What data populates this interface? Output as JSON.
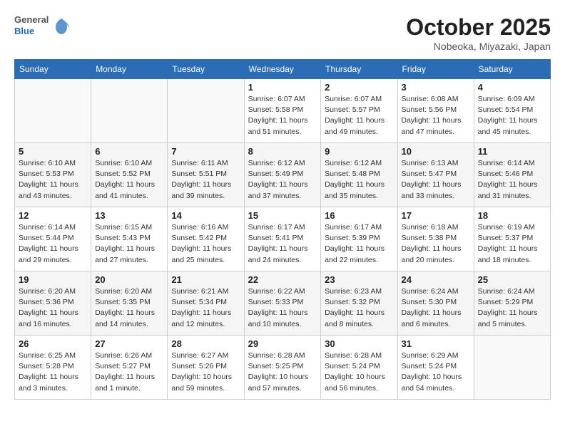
{
  "header": {
    "logo_general": "General",
    "logo_blue": "Blue",
    "month_title": "October 2025",
    "location": "Nobeoka, Miyazaki, Japan"
  },
  "weekdays": [
    "Sunday",
    "Monday",
    "Tuesday",
    "Wednesday",
    "Thursday",
    "Friday",
    "Saturday"
  ],
  "weeks": [
    [
      {
        "day": "",
        "info": ""
      },
      {
        "day": "",
        "info": ""
      },
      {
        "day": "",
        "info": ""
      },
      {
        "day": "1",
        "info": "Sunrise: 6:07 AM\nSunset: 5:58 PM\nDaylight: 11 hours\nand 51 minutes."
      },
      {
        "day": "2",
        "info": "Sunrise: 6:07 AM\nSunset: 5:57 PM\nDaylight: 11 hours\nand 49 minutes."
      },
      {
        "day": "3",
        "info": "Sunrise: 6:08 AM\nSunset: 5:56 PM\nDaylight: 11 hours\nand 47 minutes."
      },
      {
        "day": "4",
        "info": "Sunrise: 6:09 AM\nSunset: 5:54 PM\nDaylight: 11 hours\nand 45 minutes."
      }
    ],
    [
      {
        "day": "5",
        "info": "Sunrise: 6:10 AM\nSunset: 5:53 PM\nDaylight: 11 hours\nand 43 minutes."
      },
      {
        "day": "6",
        "info": "Sunrise: 6:10 AM\nSunset: 5:52 PM\nDaylight: 11 hours\nand 41 minutes."
      },
      {
        "day": "7",
        "info": "Sunrise: 6:11 AM\nSunset: 5:51 PM\nDaylight: 11 hours\nand 39 minutes."
      },
      {
        "day": "8",
        "info": "Sunrise: 6:12 AM\nSunset: 5:49 PM\nDaylight: 11 hours\nand 37 minutes."
      },
      {
        "day": "9",
        "info": "Sunrise: 6:12 AM\nSunset: 5:48 PM\nDaylight: 11 hours\nand 35 minutes."
      },
      {
        "day": "10",
        "info": "Sunrise: 6:13 AM\nSunset: 5:47 PM\nDaylight: 11 hours\nand 33 minutes."
      },
      {
        "day": "11",
        "info": "Sunrise: 6:14 AM\nSunset: 5:46 PM\nDaylight: 11 hours\nand 31 minutes."
      }
    ],
    [
      {
        "day": "12",
        "info": "Sunrise: 6:14 AM\nSunset: 5:44 PM\nDaylight: 11 hours\nand 29 minutes."
      },
      {
        "day": "13",
        "info": "Sunrise: 6:15 AM\nSunset: 5:43 PM\nDaylight: 11 hours\nand 27 minutes."
      },
      {
        "day": "14",
        "info": "Sunrise: 6:16 AM\nSunset: 5:42 PM\nDaylight: 11 hours\nand 25 minutes."
      },
      {
        "day": "15",
        "info": "Sunrise: 6:17 AM\nSunset: 5:41 PM\nDaylight: 11 hours\nand 24 minutes."
      },
      {
        "day": "16",
        "info": "Sunrise: 6:17 AM\nSunset: 5:39 PM\nDaylight: 11 hours\nand 22 minutes."
      },
      {
        "day": "17",
        "info": "Sunrise: 6:18 AM\nSunset: 5:38 PM\nDaylight: 11 hours\nand 20 minutes."
      },
      {
        "day": "18",
        "info": "Sunrise: 6:19 AM\nSunset: 5:37 PM\nDaylight: 11 hours\nand 18 minutes."
      }
    ],
    [
      {
        "day": "19",
        "info": "Sunrise: 6:20 AM\nSunset: 5:36 PM\nDaylight: 11 hours\nand 16 minutes."
      },
      {
        "day": "20",
        "info": "Sunrise: 6:20 AM\nSunset: 5:35 PM\nDaylight: 11 hours\nand 14 minutes."
      },
      {
        "day": "21",
        "info": "Sunrise: 6:21 AM\nSunset: 5:34 PM\nDaylight: 11 hours\nand 12 minutes."
      },
      {
        "day": "22",
        "info": "Sunrise: 6:22 AM\nSunset: 5:33 PM\nDaylight: 11 hours\nand 10 minutes."
      },
      {
        "day": "23",
        "info": "Sunrise: 6:23 AM\nSunset: 5:32 PM\nDaylight: 11 hours\nand 8 minutes."
      },
      {
        "day": "24",
        "info": "Sunrise: 6:24 AM\nSunset: 5:30 PM\nDaylight: 11 hours\nand 6 minutes."
      },
      {
        "day": "25",
        "info": "Sunrise: 6:24 AM\nSunset: 5:29 PM\nDaylight: 11 hours\nand 5 minutes."
      }
    ],
    [
      {
        "day": "26",
        "info": "Sunrise: 6:25 AM\nSunset: 5:28 PM\nDaylight: 11 hours\nand 3 minutes."
      },
      {
        "day": "27",
        "info": "Sunrise: 6:26 AM\nSunset: 5:27 PM\nDaylight: 11 hours\nand 1 minute."
      },
      {
        "day": "28",
        "info": "Sunrise: 6:27 AM\nSunset: 5:26 PM\nDaylight: 10 hours\nand 59 minutes."
      },
      {
        "day": "29",
        "info": "Sunrise: 6:28 AM\nSunset: 5:25 PM\nDaylight: 10 hours\nand 57 minutes."
      },
      {
        "day": "30",
        "info": "Sunrise: 6:28 AM\nSunset: 5:24 PM\nDaylight: 10 hours\nand 56 minutes."
      },
      {
        "day": "31",
        "info": "Sunrise: 6:29 AM\nSunset: 5:24 PM\nDaylight: 10 hours\nand 54 minutes."
      },
      {
        "day": "",
        "info": ""
      }
    ]
  ]
}
